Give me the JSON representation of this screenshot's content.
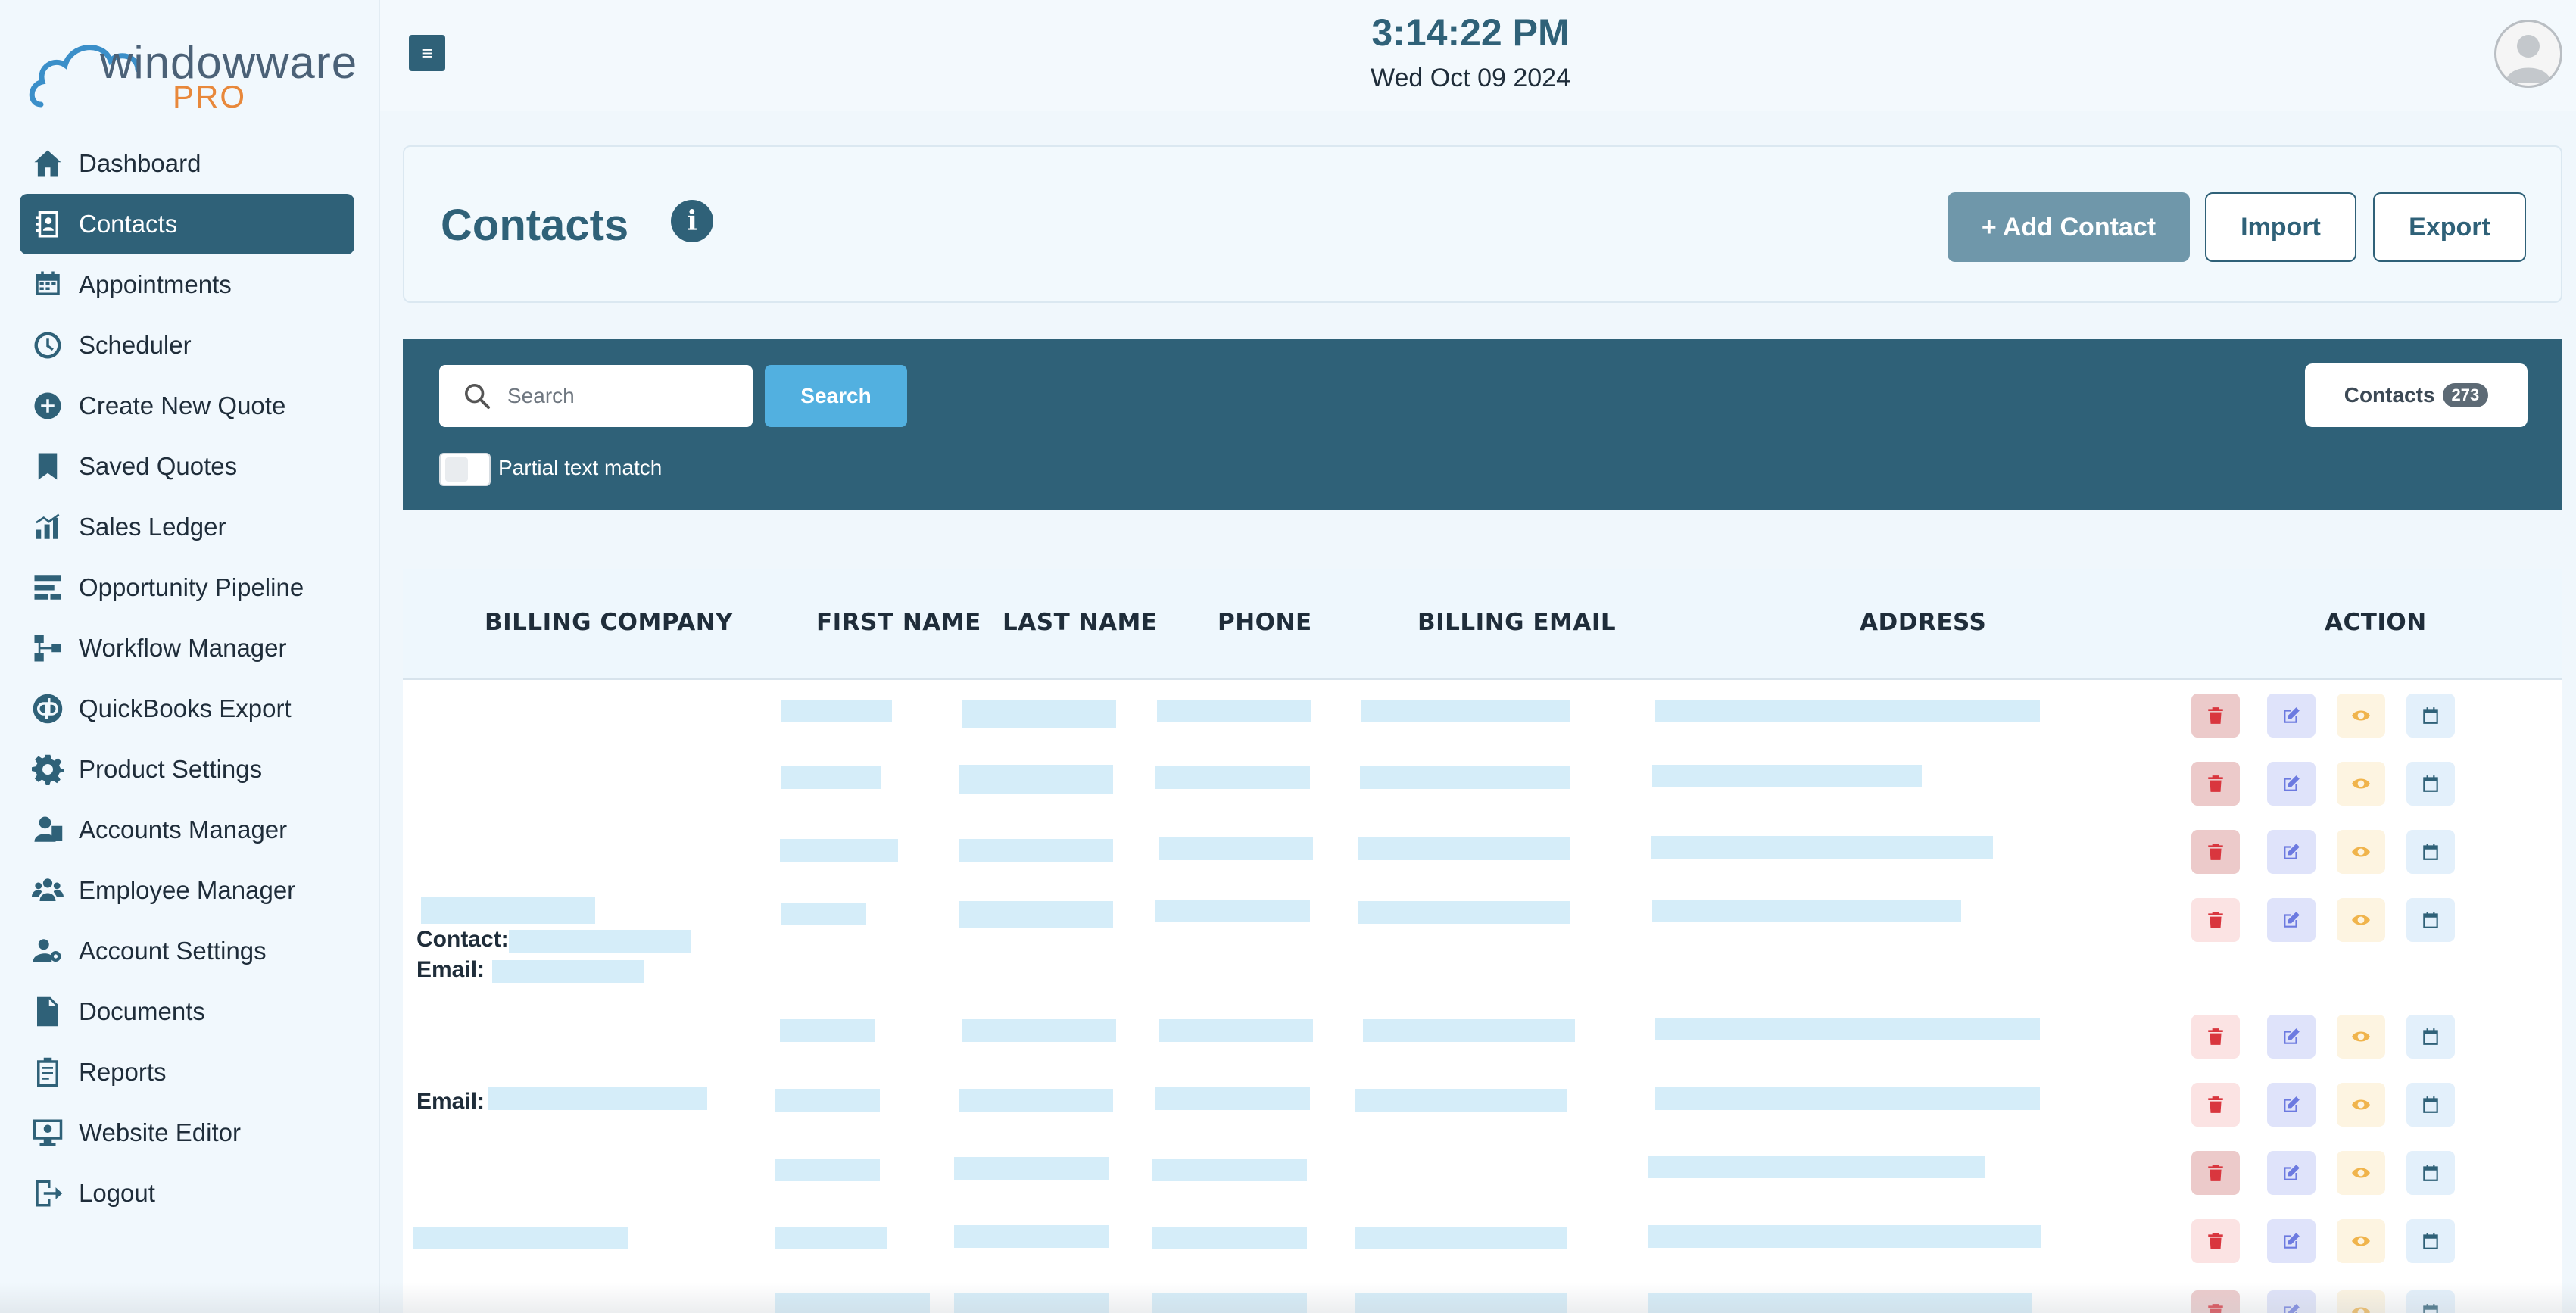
{
  "brand": {
    "name": "windowware",
    "suffix": "PRO"
  },
  "sidebar": {
    "items": [
      {
        "label": "Dashboard",
        "icon": "home-icon"
      },
      {
        "label": "Contacts",
        "icon": "contacts-icon",
        "active": true
      },
      {
        "label": "Appointments",
        "icon": "calendar-icon"
      },
      {
        "label": "Scheduler",
        "icon": "clock-icon"
      },
      {
        "label": "Create New Quote",
        "icon": "plus-circle-icon"
      },
      {
        "label": "Saved Quotes",
        "icon": "bookmark-icon"
      },
      {
        "label": "Sales Ledger",
        "icon": "bar-chart-icon"
      },
      {
        "label": "Opportunity Pipeline",
        "icon": "pipeline-icon"
      },
      {
        "label": "Workflow Manager",
        "icon": "workflow-icon"
      },
      {
        "label": "QuickBooks Export",
        "icon": "quickbooks-icon"
      },
      {
        "label": "Product Settings",
        "icon": "gear-icon"
      },
      {
        "label": "Accounts Manager",
        "icon": "accounts-icon"
      },
      {
        "label": "Employee Manager",
        "icon": "employees-icon"
      },
      {
        "label": "Account Settings",
        "icon": "user-gear-icon"
      },
      {
        "label": "Documents",
        "icon": "document-icon"
      },
      {
        "label": "Reports",
        "icon": "clipboard-icon"
      },
      {
        "label": "Website Editor",
        "icon": "monitor-icon"
      },
      {
        "label": "Logout",
        "icon": "logout-icon"
      }
    ]
  },
  "topbar": {
    "menu_glyph": "≡",
    "time": "3:14:22 PM",
    "date": "Wed Oct 09 2024"
  },
  "header": {
    "title": "Contacts",
    "add_label": "+ Add Contact",
    "import_label": "Import",
    "export_label": "Export"
  },
  "search": {
    "placeholder": "Search",
    "button_label": "Search",
    "partial_match_label": "Partial text match",
    "partial_match_checked": false,
    "count_label": "Contacts",
    "count_value": "273"
  },
  "table": {
    "columns": [
      "BILLING COMPANY",
      "FIRST NAME",
      "LAST NAME",
      "PHONE",
      "BILLING EMAIL",
      "ADDRESS",
      "ACTION"
    ],
    "row_partial_text": {
      "contact_label": "Contact:",
      "email_label": "Email:"
    }
  },
  "colors": {
    "primary": "#2f6178",
    "accent": "#52b0e0",
    "brand_orange": "#e8883b",
    "delete": "#d9363e",
    "edit": "#6c7ae0",
    "view": "#f0b44c",
    "calendar": "#2f6178"
  }
}
